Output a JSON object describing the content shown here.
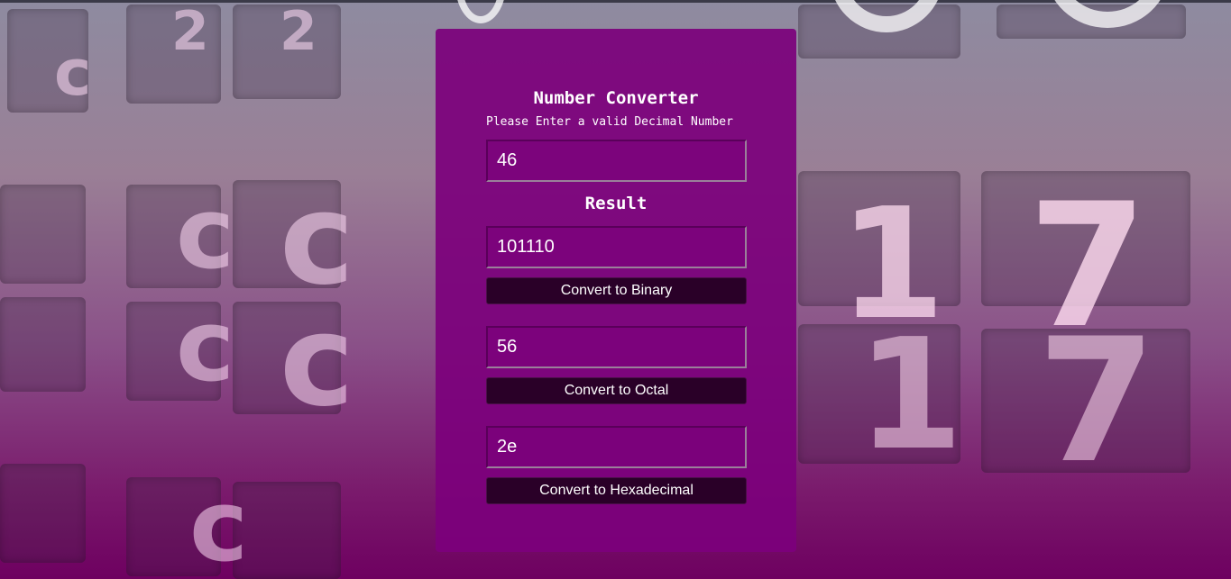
{
  "converter": {
    "title": "Number Converter",
    "prompt": "Please Enter a valid Decimal Number",
    "decimal_input": "46",
    "result_heading": "Result",
    "binary_value": "101110",
    "binary_button": "Convert to Binary",
    "octal_value": "56",
    "octal_button": "Convert to Octal",
    "hex_value": "2e",
    "hex_button": "Convert to Hexadecimal"
  },
  "colors": {
    "panel": "#7c007c",
    "button": "#2a0028",
    "text": "#ffffff"
  }
}
